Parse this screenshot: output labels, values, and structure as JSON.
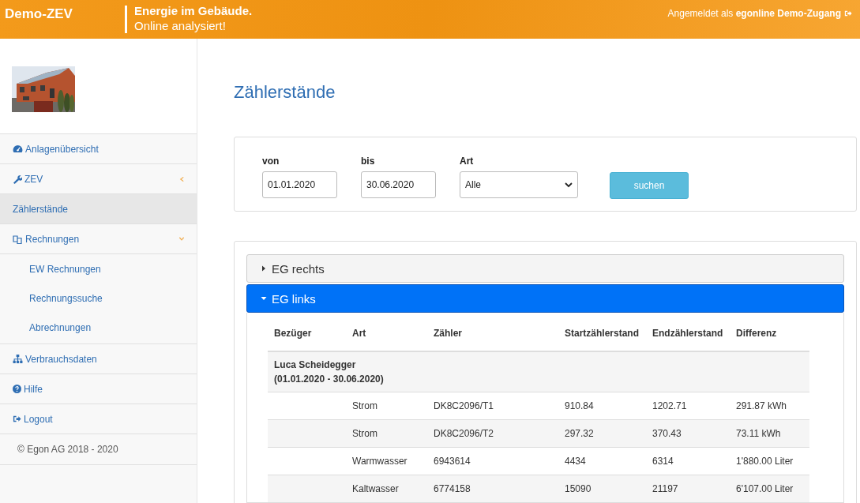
{
  "header": {
    "brand": "Demo-ZEV",
    "tagline_1": "Energie im Gebäude.",
    "tagline_2": "Online analysiert!",
    "user": "Angemeldet als **egonline Demo-Zugang**"
  },
  "sidebar": {
    "items": [
      {
        "label": "Anlagenübersicht",
        "selected": false
      },
      {
        "label": "ZEV",
        "selected": false,
        "expanded": false
      },
      {
        "label": "Zählerstände",
        "selected": true
      },
      {
        "label": "Rechnungen",
        "selected": false,
        "expanded": true,
        "children": [
          {
            "label": "EW Rechnungen",
            "selected": false
          },
          {
            "label": "Rechnungssuche",
            "selected": false
          },
          {
            "label": "Abrechnungen",
            "selected": false
          }
        ]
      },
      {
        "label": "Verbrauchsdaten",
        "selected": false
      },
      {
        "label": "Hilfe",
        "selected": false
      },
      {
        "label": "Logout",
        "selected": false
      }
    ],
    "footer": "© Egon AG 2018 - 2020"
  },
  "page": {
    "title": "Zählerstände"
  },
  "filter": {
    "from": {
      "label": "von",
      "value": "01.01.2020"
    },
    "to": {
      "label": "bis",
      "value": "30.06.2020"
    },
    "type": {
      "label": "Art",
      "value": "Alle"
    },
    "button": "suchen"
  },
  "panels": [
    {
      "title": "EG rechts",
      "expanded": false
    },
    {
      "title": "EG links",
      "expanded": true,
      "table": {
        "columns": [
          "Bezüger",
          "Art",
          "Zähler",
          "Startzählerstand",
          "Endzählerstand",
          "Differenz"
        ],
        "groups": [
          {
            "name": "Luca Scheidegger",
            "period": "(01.01.2020 - 30.06.2020)",
            "rows": [
              [
                "Strom",
                "DK8C2096/T1",
                "910.84",
                "1202.71",
                "291.87 kWh"
              ],
              [
                "Strom",
                "DK8C2096/T2",
                "297.32",
                "370.43",
                "73.11 kWh"
              ],
              [
                "Warmwasser",
                "6943614",
                "4434",
                "6314",
                "1'880.00 Liter"
              ],
              [
                "Kaltwasser",
                "6774158",
                "15090",
                "21197",
                "6'107.00 Liter"
              ]
            ]
          }
        ]
      }
    }
  ]
}
